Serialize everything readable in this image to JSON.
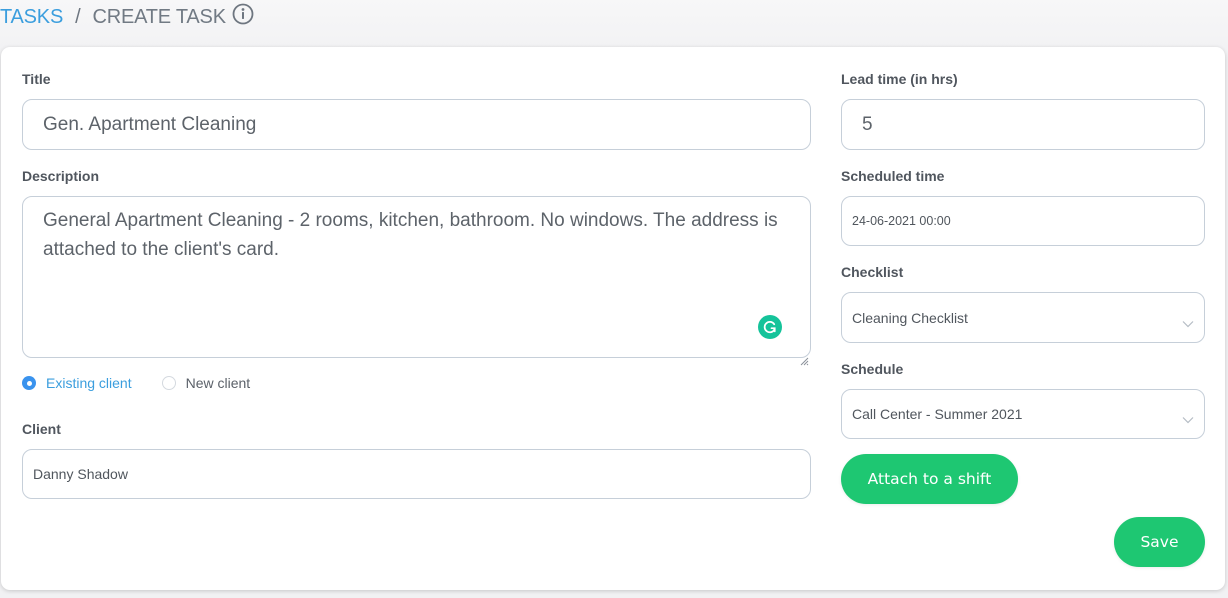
{
  "breadcrumb": {
    "parent": "TASKS",
    "separator": "/",
    "current": "CREATE TASK",
    "info_icon": "info-circle-icon"
  },
  "form": {
    "title": {
      "label": "Title",
      "value": "Gen. Apartment Cleaning"
    },
    "description": {
      "label": "Description",
      "value": "General Apartment Cleaning - 2 rooms, kitchen, bathroom. No windows. The address is attached to the client's card.",
      "extension_icon": "grammarly-icon"
    },
    "client_type": {
      "options": [
        {
          "label": "Existing client",
          "selected": true
        },
        {
          "label": "New client",
          "selected": false
        }
      ]
    },
    "client": {
      "label": "Client",
      "value": "Danny Shadow"
    },
    "lead_time": {
      "label": "Lead time (in hrs)",
      "value": "5"
    },
    "scheduled_time": {
      "label": "Scheduled time",
      "value": "24-06-2021 00:00"
    },
    "checklist": {
      "label": "Checklist",
      "selected": "Cleaning Checklist",
      "icon": "chevron-down-icon"
    },
    "schedule": {
      "label": "Schedule",
      "selected": "Call Center - Summer 2021",
      "icon": "chevron-down-icon"
    }
  },
  "buttons": {
    "attach_shift": "Attach to a shift",
    "save": "Save"
  },
  "colors": {
    "accent_blue": "#3b9ede",
    "radio_blue": "#3a93ee",
    "primary_green": "#1ec772",
    "grammarly_green": "#15c39a"
  }
}
